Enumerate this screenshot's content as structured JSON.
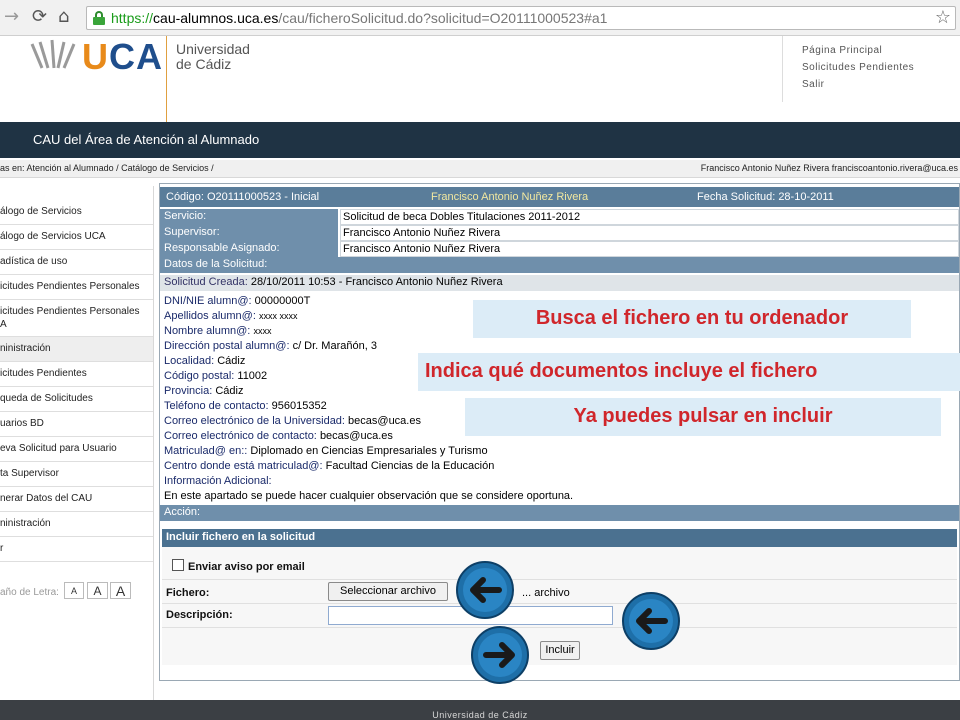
{
  "browser": {
    "url_scheme": "https://",
    "url_host": "cau-alumnos.uca.es",
    "url_path": "/cau/ficheroSolicitud.do?solicitud=O20111000523#a1"
  },
  "header": {
    "logo_u": "U",
    "logo_ca": "CA",
    "logo_line1": "Universidad",
    "logo_line2": "de Cádiz",
    "links": [
      "Página Principal",
      "Solicitudes Pendientes",
      "Salir"
    ]
  },
  "band": {
    "title": "CAU del Área de Atención al Alumnado"
  },
  "breadcrumb": {
    "left": "as en: Atención al Alumnado / Catálogo de Servicios /",
    "right": "Francisco Antonio Nuñez Rivera  franciscoantonio.rivera@uca.es"
  },
  "sidebar": {
    "items": [
      "álogo de Servicios",
      "álogo de Servicios UCA",
      "adística de uso",
      "icitudes Pendientes Personales",
      "icitudes Pendientes Personales",
      "ninistración",
      "icitudes Pendientes",
      "queda de Solicitudes",
      "uarios BD",
      "eva Solicitud para Usuario",
      "ta Supervisor",
      "nerar Datos del CAU",
      "ninistración",
      "r"
    ],
    "item5_extra": "A",
    "font_label": "año de Letra:",
    "font_buttons": [
      "A",
      "A",
      "A"
    ]
  },
  "request": {
    "code": "Código: O20111000523 - Inicial",
    "name": "Francisco Antonio Nuñez Rivera",
    "date": "Fecha Solicitud: 28-10-2011",
    "servicio_label": "Servicio:",
    "servicio": "Solicitud de beca Dobles Titulaciones 2011-2012",
    "supervisor_label": "Supervisor:",
    "supervisor": "Francisco Antonio Nuñez Rivera",
    "responsable_label": "Responsable Asignado:",
    "responsable": "Francisco Antonio Nuñez Rivera",
    "datos_label": "Datos de la Solicitud:",
    "created_label": "Solicitud Creada:",
    "created": "28/10/2011 10:53 - Francisco Antonio Nuñez Rivera",
    "details": [
      {
        "label": "DNI/NIE alumn@:",
        "value": "00000000T"
      },
      {
        "label": "Apellidos alumn@:",
        "value": "xxxx xxxx"
      },
      {
        "label": "Nombre alumn@:",
        "value": "xxxx"
      },
      {
        "label": "Dirección postal alumn@:",
        "value": "c/ Dr. Marañón, 3"
      },
      {
        "label": "Localidad:",
        "value": "Cádiz"
      },
      {
        "label": "Código postal:",
        "value": "11002"
      },
      {
        "label": "Provincia:",
        "value": "Cádiz"
      },
      {
        "label": "Teléfono de contacto:",
        "value": "956015352"
      },
      {
        "label": "Correo electrónico de la Universidad:",
        "value": "becas@uca.es"
      },
      {
        "label": "Correo electrónico de contacto:",
        "value": "becas@uca.es"
      },
      {
        "label": "Matriculad@ en::",
        "value": "Diplomado en Ciencias Empresariales y Turismo"
      },
      {
        "label": "Centro donde está matriculad@:",
        "value": "Facultad Ciencias de la Educación"
      },
      {
        "label": "Información Adicional:",
        "value": ""
      }
    ],
    "additional_info": "En este apartado se puede hacer cualquier observación que se considere oportuna.",
    "accion_label": "Acción:"
  },
  "form": {
    "title": "Incluir fichero en la solicitud",
    "notify_label": "Enviar aviso por email",
    "file_label": "Fichero:",
    "file_button": "Seleccionar archivo",
    "file_status": "... archivo",
    "desc_label": "Descripción:",
    "description_value": "",
    "submit": "Incluir"
  },
  "callouts": {
    "find_file": "Busca el fichero en tu ordenador",
    "indicate_docs": "Indica qué documentos incluye el fichero",
    "press_include": "Ya puedes pulsar en incluir"
  },
  "footer": {
    "text": "Universidad de Cádiz"
  },
  "colors": {
    "band": "#1f3344",
    "panel_header": "#5a7d9a",
    "callout_text": "#d0262b",
    "callout_bg": "#dcecf7",
    "arrow": "#1e6fa8"
  }
}
